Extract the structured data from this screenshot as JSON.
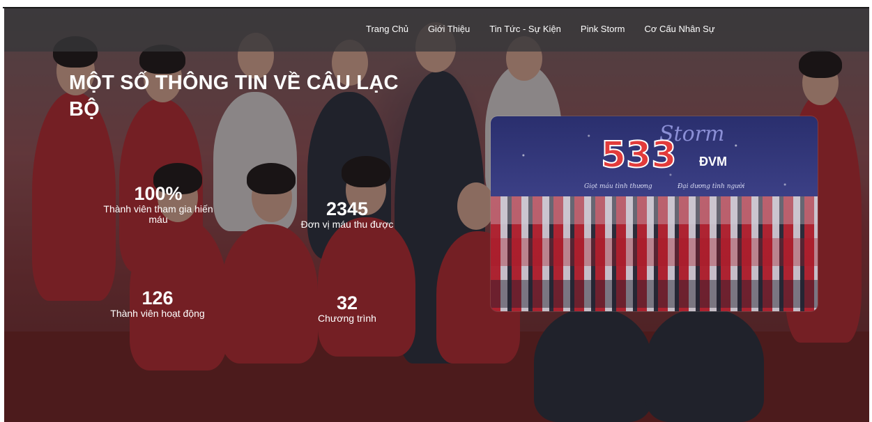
{
  "nav": {
    "items": [
      "Trang Chủ",
      "Giới Thiệu",
      "Tin Tức - Sự Kiện",
      "Pink Storm",
      "Cơ Cấu Nhân Sự"
    ]
  },
  "section": {
    "title_line1": "MỘT SỐ THÔNG TIN VỀ CÂU LẠC",
    "title_line2": "BỘ"
  },
  "stats": [
    {
      "value": "100%",
      "label": "Thành viên tham gia hiến máu"
    },
    {
      "value": "2345",
      "label": "Đơn vị máu thu được"
    },
    {
      "value": "126",
      "label": "Thành viên hoạt động"
    },
    {
      "value": "32",
      "label": "Chương trình"
    }
  ],
  "feature": {
    "count": "533",
    "unit": "ĐVM",
    "script": "Storm",
    "tag_left": "Giọt máu tình thương",
    "tag_right": "Đại dương tình người"
  }
}
